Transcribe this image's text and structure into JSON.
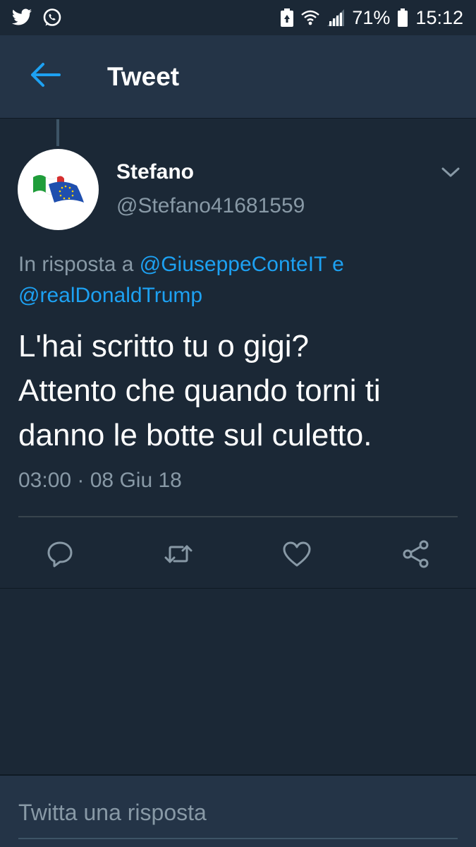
{
  "status_bar": {
    "battery_percent": "71%",
    "time": "15:12"
  },
  "header": {
    "title": "Tweet"
  },
  "tweet": {
    "author_name": "Stefano",
    "author_handle": "@Stefano41681559",
    "reply_prefix": "In risposta a",
    "reply_mention_1": "@GiuseppeConteIT",
    "reply_joiner": "e",
    "reply_mention_2": "@realDonaldTrump",
    "text_line_1": "L'hai scritto tu o gigi?",
    "text_line_2": "Attento che quando torni ti",
    "text_line_3": "danno le botte sul culetto.",
    "timestamp": "03:00 · 08 Giu 18"
  },
  "composer": {
    "placeholder": "Twitta una risposta"
  },
  "colors": {
    "background": "#1b2836",
    "header_bg": "#243447",
    "accent": "#1da1f2",
    "secondary_text": "#8899a6"
  },
  "icons": {
    "status_left": [
      "twitter-icon",
      "whatsapp-icon"
    ],
    "status_right": [
      "battery-saver-icon",
      "wifi-icon",
      "signal-icon",
      "battery-icon"
    ],
    "header": "back-arrow-icon",
    "tweet_menu": "chevron-down-icon",
    "actions": [
      "reply-icon",
      "retweet-icon",
      "like-icon",
      "share-icon"
    ]
  }
}
